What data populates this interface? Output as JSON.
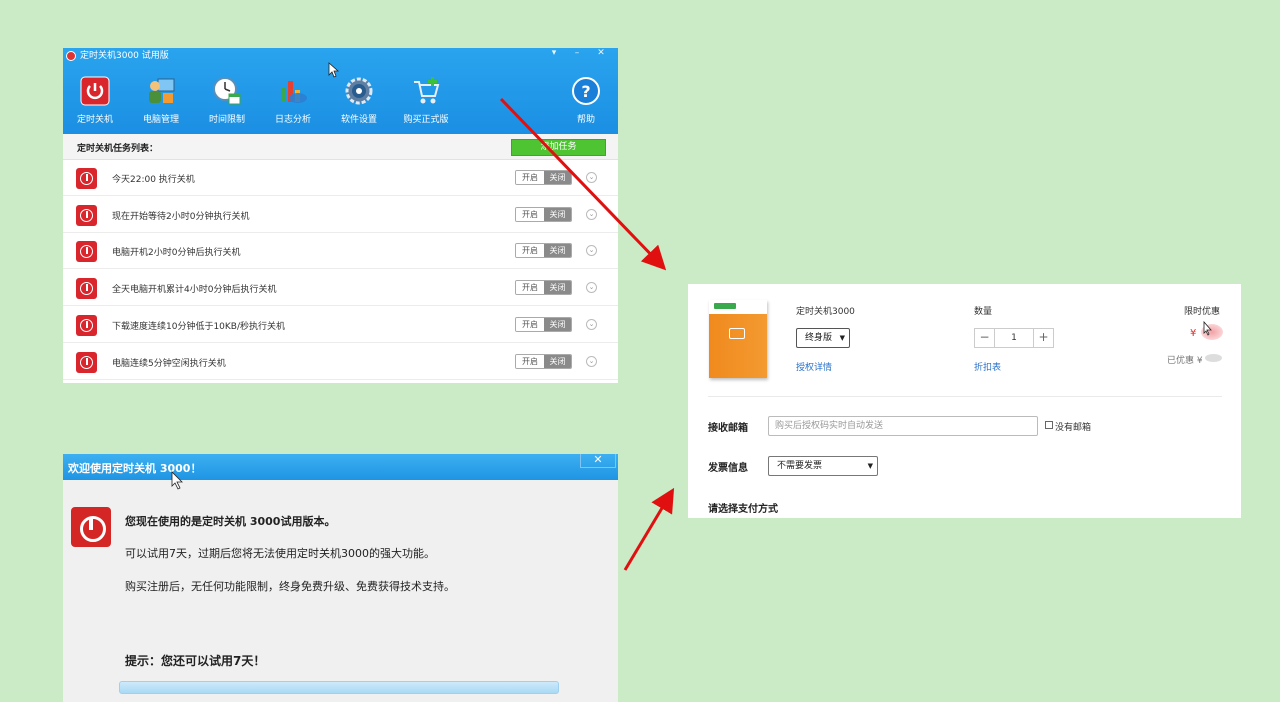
{
  "app": {
    "title": "定时关机3000 试用版",
    "window_controls": {
      "restore": "▾",
      "minimize": "–",
      "close": "✕"
    },
    "toolbar": [
      {
        "label": "定时关机",
        "icon": "power-icon"
      },
      {
        "label": "电脑管理",
        "icon": "computer-manage-icon"
      },
      {
        "label": "时间限制",
        "icon": "clock-calendar-icon"
      },
      {
        "label": "日志分析",
        "icon": "chart-icon"
      },
      {
        "label": "软件设置",
        "icon": "gear-icon"
      },
      {
        "label": "购买正式版",
        "icon": "cart-icon"
      },
      {
        "label": "帮助",
        "icon": "help-icon"
      }
    ],
    "task_list_title": "定时关机任务列表：",
    "add_task_label": "添加任务",
    "toggle_on": "开启",
    "toggle_off": "关闭",
    "tasks": [
      {
        "text": "今天22:00 执行关机"
      },
      {
        "text": "现在开始等待2小时0分钟执行关机"
      },
      {
        "text": "电脑开机2小时0分钟后执行关机"
      },
      {
        "text": "全天电脑开机累计4小时0分钟后执行关机"
      },
      {
        "text": "下载速度连续10分钟低于10KB/秒执行关机"
      },
      {
        "text": "电脑连续5分钟空闲执行关机"
      }
    ]
  },
  "welcome": {
    "title": "欢迎使用定时关机 3000！",
    "close": "✕",
    "headline": "您现在使用的是定时关机 3000试用版本。",
    "trial_text": "可以试用7天，过期后您将无法使用定时关机3000的强大功能。",
    "buy_text": "购买注册后，无任何功能限制，终身免费升级、免费获得技术支持。",
    "tip": "提示：您还可以试用7天！"
  },
  "purchase": {
    "product_name": "定时关机3000",
    "edition": "终身版",
    "license_link": "授权详情",
    "qty_label": "数量",
    "qty_minus": "−",
    "qty_value": "1",
    "qty_plus": "+",
    "discount_link": "折扣表",
    "promo_label": "限时优惠",
    "price_symbol": "¥",
    "saved_label": "已优惠 ¥",
    "email_label": "接收邮箱",
    "email_placeholder": "购买后授权码实时自动发送",
    "no_email_label": "没有邮箱",
    "invoice_label": "发票信息",
    "invoice_option": "不需要发票",
    "payment_label": "请选择支付方式"
  },
  "colors": {
    "background": "#cbeac6",
    "header_blue": "#1b8fe3",
    "add_green": "#4fc432",
    "power_red": "#d9262d",
    "arrow_red": "#e01010",
    "link_blue": "#2a72c8"
  }
}
